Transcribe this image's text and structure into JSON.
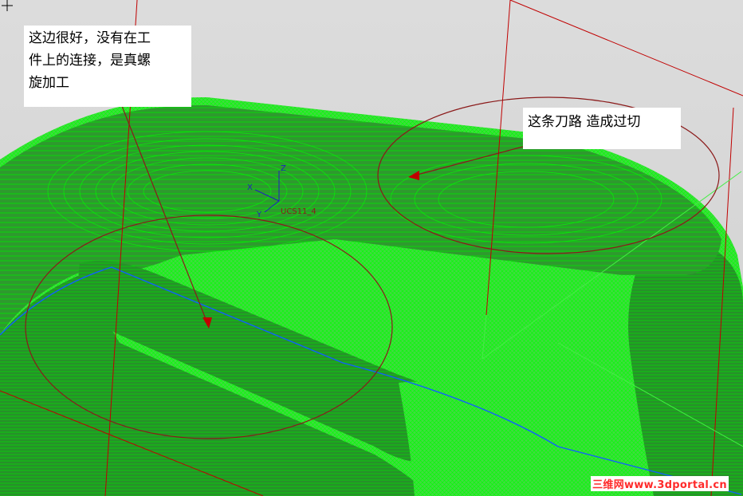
{
  "annotations": {
    "left_note": "这边很好，没有在工\n件上的连接，是真螺\n旋加工",
    "right_note": "这条刀路 造成过切"
  },
  "ucs": {
    "label": "UCS11_4",
    "axis_x": "X",
    "axis_y": "Y",
    "axis_z": "Z"
  },
  "watermark": "三维网www.3dportal.cn",
  "colors": {
    "toolpath": "#00e000",
    "toolpath_dark": "#1f8f1f",
    "wireframe": "#c00000",
    "edge": "#1060ff",
    "annotation_ellipse": "#8b1a1a",
    "background": "#d4d4d4"
  }
}
